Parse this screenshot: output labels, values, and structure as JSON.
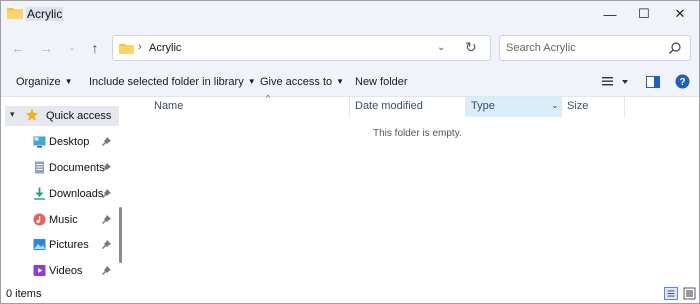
{
  "window": {
    "title": "Acrylic",
    "minimize_glyph": "—",
    "maximize_glyph": "☐",
    "close_glyph": "✕"
  },
  "nav": {
    "back_glyph": "←",
    "forward_glyph": "→",
    "recent_glyph": "⌄",
    "up_glyph": "↑"
  },
  "address": {
    "separator": "›",
    "path": "Acrylic",
    "dropdown_glyph": "⌄",
    "refresh_glyph": "↻"
  },
  "search": {
    "placeholder": "Search Acrylic"
  },
  "commands": {
    "organize": "Organize",
    "include": "Include selected folder in library",
    "give_access": "Give access to",
    "new_folder": "New folder",
    "caret": "▼"
  },
  "sidebar": {
    "quick_access": "Quick access",
    "items": [
      {
        "label": "Desktop",
        "icon": "desktop-icon",
        "pinned": true
      },
      {
        "label": "Documents",
        "icon": "documents-icon",
        "pinned": true
      },
      {
        "label": "Downloads",
        "icon": "downloads-icon",
        "pinned": true
      },
      {
        "label": "Music",
        "icon": "music-icon",
        "pinned": true
      },
      {
        "label": "Pictures",
        "icon": "pictures-icon",
        "pinned": true
      },
      {
        "label": "Videos",
        "icon": "videos-icon",
        "pinned": true
      }
    ]
  },
  "columns": {
    "name": "Name",
    "date_modified": "Date modified",
    "type": "Type",
    "size": "Size",
    "sort_glyph": "^",
    "type_filter_glyph": "⌄"
  },
  "content": {
    "empty_message": "This folder is empty."
  },
  "status": {
    "item_count": "0 items"
  },
  "colors": {
    "chrome_bg": "#f0f3f9",
    "accent": "#0067c0",
    "selected_column_bg": "#d9eefb",
    "folder_yellow": "#f5c242"
  }
}
